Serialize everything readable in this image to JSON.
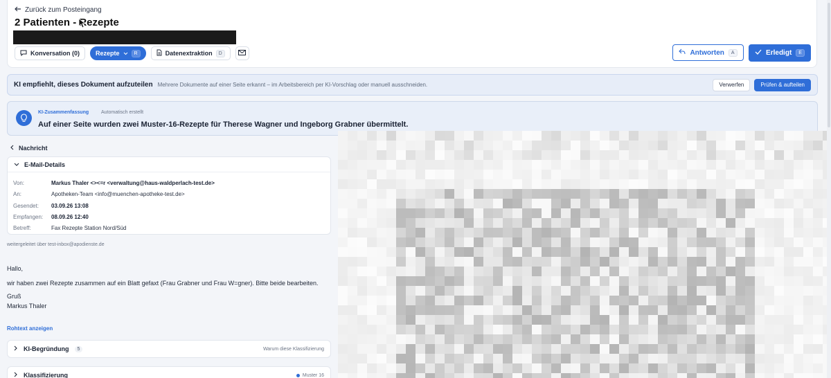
{
  "header": {
    "back_label": "Zurück zum Posteingang",
    "title": "2 Patienten - Rezepte",
    "tabs": [
      {
        "label": "Konversation (0)",
        "icon": "chat-bubble-icon"
      },
      {
        "label": "Rezepte",
        "icon": "chevron-down-icon",
        "shortcut": "R"
      },
      {
        "label": "Datenextraktion",
        "icon": "document-icon",
        "shortcut": "D"
      }
    ],
    "reply": {
      "label": "Antworten",
      "shortcut": "A"
    },
    "done": {
      "label": "Erledigt",
      "shortcut": "E"
    }
  },
  "split_banner": {
    "title": "KI empfiehlt, dieses Dokument aufzuteilen",
    "text": "Mehrere Dokumente auf einer Seite erkannt – im Arbeitsbereich per KI-Vorschlag oder manuell ausschneiden.",
    "dismiss_label": "Verwerfen",
    "confirm_label": "Prüfen & aufteilen"
  },
  "summary": {
    "label": "KI-Zusammenfassung",
    "meta": "Automatisch erstellt",
    "text": "Auf einer Seite wurden zwei Muster-16-Rezepte für Therese Wagner und Ingeborg Grabner übermittelt."
  },
  "message": {
    "heading": "Nachricht",
    "details_heading": "E-Mail-Details",
    "fields": {
      "from_key": "Von:",
      "from_val": "Markus Thaler <><=r <verwaltung@haus-waldperlach-test.de>",
      "to_key": "An:",
      "to_val": "Apotheken-Team <info@muenchen-apotheke-test.de>",
      "sent_key": "Gesendet:",
      "sent_val": "03.09.26 13:08",
      "recv_key": "Empfangen:",
      "recv_val": "08.09.26 12:40",
      "subject_key": "Betreff:",
      "subject_val": "Fax Rezepte Station Nord/Süd"
    },
    "forwarded": "weitergeleitet über test-inbox@apodienste.de",
    "body": {
      "greeting": "Hallo,",
      "line1": "wir haben zwei Rezepte zusammen auf ein Blatt gefaxt (Frau Grabner und Frau W=gner). Bitte beide bearbeiten.",
      "closing": "Gruß",
      "signature": "Markus Thaler"
    },
    "raw_link": "Rohtext anzeigen",
    "reasoning": {
      "label": "KI-Begründung",
      "count": "5",
      "hint": "Warum diese Klassifizierung"
    },
    "classification": {
      "label": "Klassifizierung",
      "value": "Muster 16"
    }
  },
  "colors": {
    "accent": "#2f6ed8",
    "background": "#f3f5f9"
  }
}
